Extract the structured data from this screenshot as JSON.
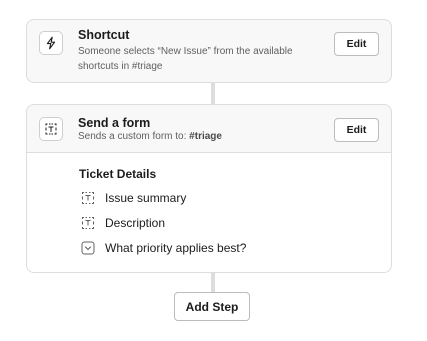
{
  "steps": [
    {
      "title": "Shortcut",
      "icon": "lightning-bolt-icon",
      "description_line1": "Someone selects “New Issue” from the available",
      "description_line2": "shortcuts in #triage",
      "edit_label": "Edit"
    },
    {
      "title": "Send a form",
      "icon": "form-icon",
      "description_prefix": "Sends a custom form to: ",
      "description_channel": "#triage",
      "edit_label": "Edit"
    }
  ],
  "form": {
    "title": "Ticket Details",
    "fields": [
      {
        "label": "Issue summary",
        "icon": "text-field-icon"
      },
      {
        "label": "Description",
        "icon": "text-field-icon"
      },
      {
        "label": "What priority applies best?",
        "icon": "dropdown-icon"
      }
    ]
  },
  "add_step_label": "Add Step"
}
